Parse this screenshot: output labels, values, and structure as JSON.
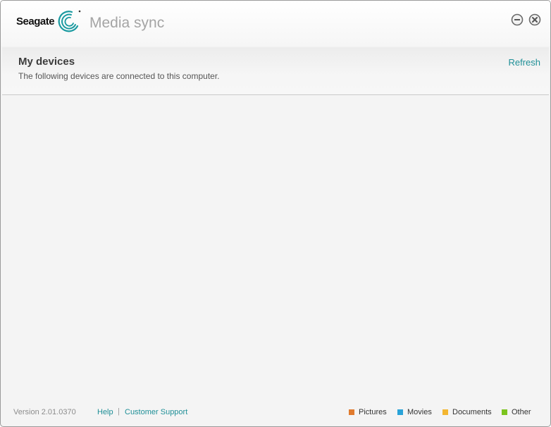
{
  "brand": {
    "logo_text": "Seagate",
    "app_title": "Media sync",
    "accent": "#1f8f97"
  },
  "window_controls": {
    "minimize_icon": "minimize-circle-icon",
    "close_icon": "close-circle-icon"
  },
  "devices": {
    "title": "My devices",
    "description": "The following devices are connected to this computer.",
    "refresh_label": "Refresh",
    "items": []
  },
  "footer": {
    "version": "Version 2.01.0370",
    "help_label": "Help",
    "separator": "|",
    "support_label": "Customer Support"
  },
  "legend": [
    {
      "label": "Pictures",
      "color": "#e07b2e"
    },
    {
      "label": "Movies",
      "color": "#2aa3d8"
    },
    {
      "label": "Documents",
      "color": "#f3b631"
    },
    {
      "label": "Other",
      "color": "#7cc41f"
    }
  ]
}
